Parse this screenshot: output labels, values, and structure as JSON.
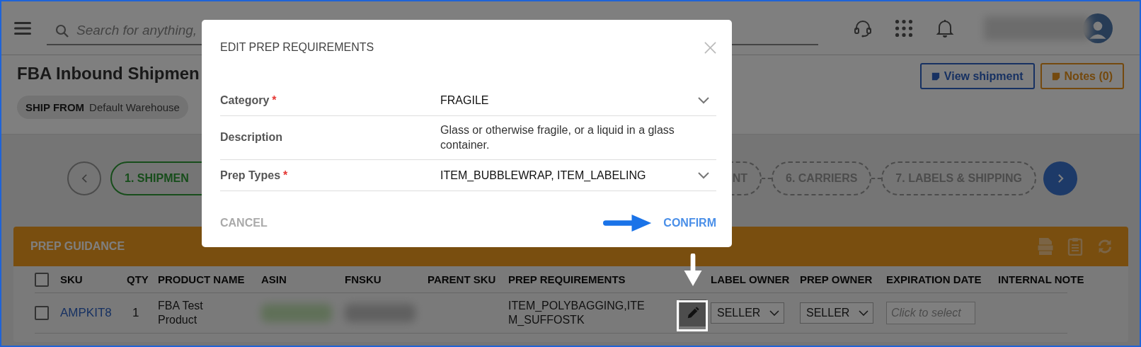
{
  "topbar": {
    "search_placeholder": "Search for anything,"
  },
  "header": {
    "title": "FBA Inbound Shipmen",
    "ship_from": {
      "label": "SHIP FROM",
      "value": "Default Warehouse"
    },
    "buttons": [
      {
        "label": "View shipment",
        "kind": "primary"
      },
      {
        "label": "Notes (0)",
        "kind": "notes"
      }
    ]
  },
  "stepper": {
    "steps": [
      {
        "label": "1. SHIPMEN",
        "selected": true
      },
      {
        "label": "NT",
        "selected": false
      },
      {
        "label": "6. CARRIERS",
        "selected": false
      },
      {
        "label": "7. LABELS & SHIPPING",
        "selected": false
      }
    ]
  },
  "prep_guidance": {
    "title": "PREP GUIDANCE",
    "select_all_checked": false,
    "columns": [
      "SKU",
      "QTY",
      "PRODUCT NAME",
      "ASIN",
      "FNSKU",
      "PARENT SKU",
      "PREP REQUIREMENTS",
      "LABEL OWNER",
      "PREP OWNER",
      "EXPIRATION DATE",
      "INTERNAL NOTE"
    ],
    "rows": [
      {
        "checked": false,
        "sku": "AMPKIT8",
        "qty": "1",
        "product_name": "FBA Test Product",
        "prep_requirements": "ITEM_POLYBAGGING,ITEM_SUFFOSTK",
        "label_owner": "SELLER",
        "prep_owner": "SELLER",
        "expiration_placeholder": "Click to select"
      }
    ]
  },
  "modal": {
    "title": "EDIT PREP REQUIREMENTS",
    "fields": [
      {
        "label": "Category",
        "required_mark": "*",
        "value": "FRAGILE",
        "kind": "select"
      },
      {
        "label": "Description",
        "value": "Glass or otherwise fragile, or a liquid in a glass container.",
        "kind": "text"
      },
      {
        "label": "Prep Types",
        "required_mark": "*",
        "value": "ITEM_BUBBLEWRAP, ITEM_LABELING",
        "kind": "select"
      }
    ],
    "cancel": "CANCEL",
    "confirm": "CONFIRM"
  }
}
